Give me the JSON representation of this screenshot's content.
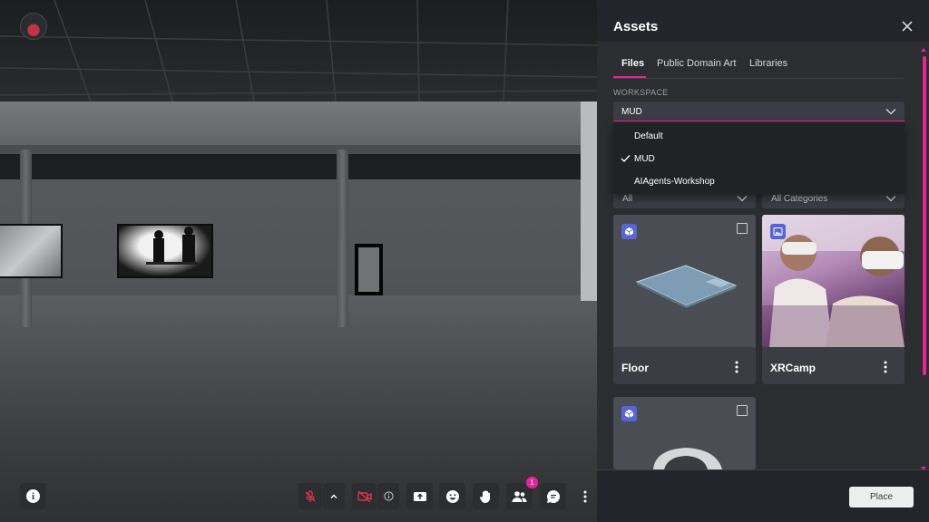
{
  "panel": {
    "title": "Assets",
    "tabs": [
      {
        "label": "Files",
        "active": true
      },
      {
        "label": "Public Domain Art",
        "active": false
      },
      {
        "label": "Libraries",
        "active": false
      }
    ],
    "workspace_label": "WORKSPACE",
    "workspace_value": "MUD",
    "workspace_options": [
      {
        "label": "Default",
        "selected": false
      },
      {
        "label": "MUD",
        "selected": true
      },
      {
        "label": "AIAgents-Workshop",
        "selected": false
      }
    ],
    "filter_type_value": "All",
    "filter_category_value": "All Categories",
    "assets": [
      {
        "name": "Floor",
        "type_icon": "cube-icon"
      },
      {
        "name": "XRCamp",
        "type_icon": "image-icon"
      },
      {
        "name": "",
        "type_icon": "cube-icon"
      }
    ],
    "place_label": "Place"
  },
  "toolbar": {
    "participants_badge": "1",
    "info_glyph": "i"
  },
  "colors": {
    "accent": "#e6259a",
    "panel_bg": "#2b2d31",
    "card_bg": "#3a3d43",
    "type_badge": "#5865d6",
    "mute_red": "#e0334a"
  }
}
